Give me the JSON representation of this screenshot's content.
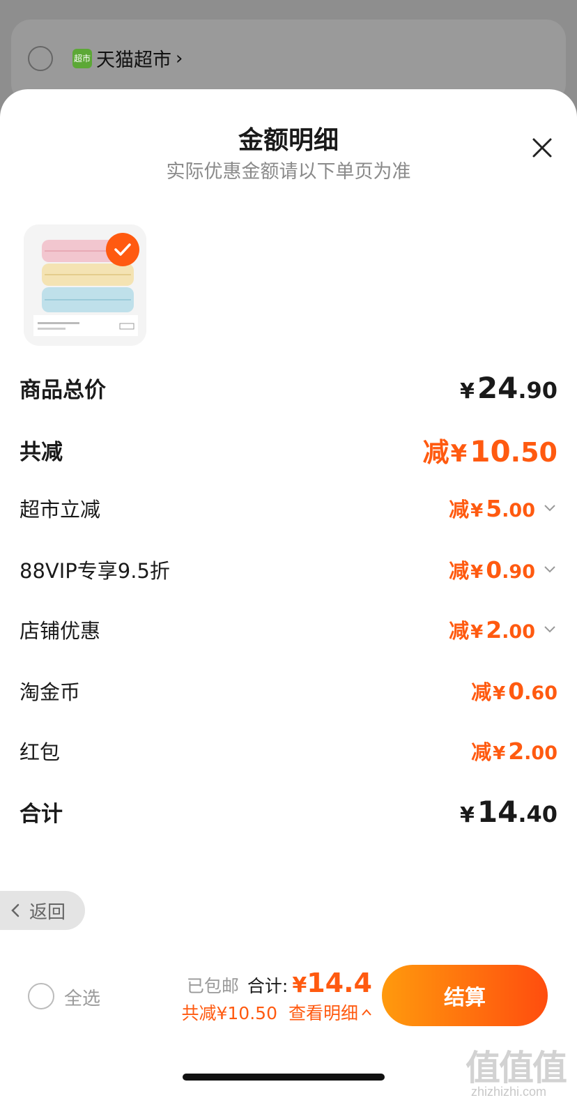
{
  "background": {
    "store_name": "天猫超市",
    "store_logo_text": "超市"
  },
  "sheet": {
    "title": "金额明细",
    "subtitle": "实际优惠金额请以下单页为准"
  },
  "product": {
    "image_caption": "towels"
  },
  "rows": {
    "goods_total": {
      "label": "商品总价",
      "yen": "¥",
      "int": "24",
      "dec": ".90"
    },
    "total_discount": {
      "label": "共减",
      "pre": "减",
      "yen": "¥",
      "int": "10",
      "dec": ".50"
    },
    "discounts": [
      {
        "label": "超市立减",
        "pre": "减",
        "yen": "¥",
        "int": "5",
        "dec": ".00"
      },
      {
        "label": "88VIP专享9.5折",
        "pre": "减",
        "yen": "¥",
        "int": "0",
        "dec": ".90"
      },
      {
        "label": "店铺优惠",
        "pre": "减",
        "yen": "¥",
        "int": "2",
        "dec": ".00"
      },
      {
        "label": "淘金币",
        "pre": "减",
        "yen": "¥",
        "int": "0",
        "dec": ".60"
      },
      {
        "label": "红包",
        "pre": "减",
        "yen": "¥",
        "int": "2",
        "dec": ".00"
      }
    ],
    "sum": {
      "label": "合计",
      "yen": "¥",
      "int": "14",
      "dec": ".40"
    }
  },
  "back_button": {
    "label": "返回"
  },
  "footer": {
    "select_all": "全选",
    "free_shipping": "已包邮",
    "total_label": "合计:",
    "total_yen": "¥",
    "total_value": "14.4",
    "discount_text": "共减¥10.50",
    "detail_link": "查看明细",
    "checkout": "结算"
  },
  "watermark": {
    "text": "值值值",
    "url": "zhizhizhi.com"
  },
  "colors": {
    "accent": "#ff5a10",
    "checkout_gradient_start": "#ff9a0d",
    "checkout_gradient_end": "#ff4d0e"
  }
}
